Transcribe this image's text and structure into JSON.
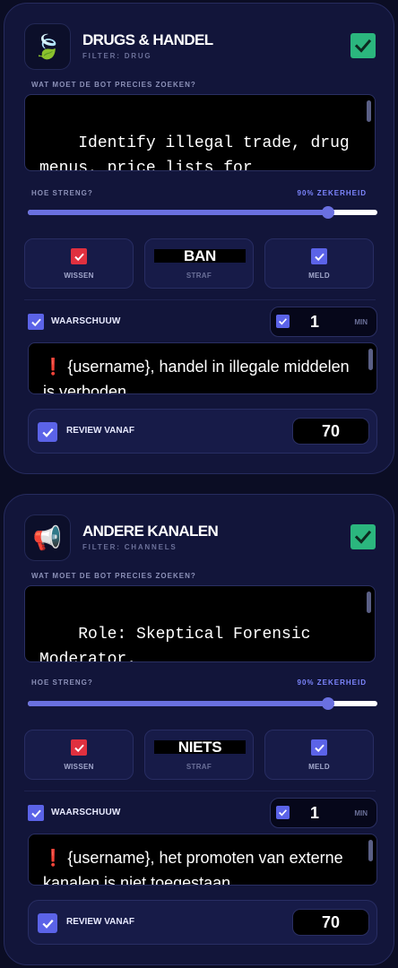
{
  "cards": [
    {
      "icon": "leaf-icon",
      "icon_glyph": "🍃",
      "title": "DRUGS & HANDEL",
      "filter": "FILTER: DRUG",
      "search_label": "WAT MOET DE BOT PRECIES ZOEKEN?",
      "search_text": "Identify illegal trade, drug menus, price lists for controlled substances, and",
      "strict_label": "HOE STRENG?",
      "strict_value_text": "90% ZEKERHEID",
      "strict_value": 0.9,
      "options": {
        "wipe_label": "WISSEN",
        "penalty_value": "BAN",
        "penalty_label": "STRAF",
        "report_label": "MELD"
      },
      "warn_label": "WAARSCHUUW",
      "warn_minutes": "1",
      "warn_unit": "MIN",
      "warn_message": "❗ {username}, handel in illegale middelen is verboden",
      "review_label": "REVIEW VANAF",
      "review_value": "70"
    },
    {
      "icon": "megaphone-icon",
      "icon_glyph": "📢",
      "title": "ANDERE KANALEN",
      "filter": "FILTER: CHANNELS",
      "search_label": "WAT MOET DE BOT PRECIES ZOEKEN?",
      "search_text": "Role: Skeptical Forensic Moderator.\nTarget: Telegram channel",
      "strict_label": "HOE STRENG?",
      "strict_value_text": "90% ZEKERHEID",
      "strict_value": 0.9,
      "options": {
        "wipe_label": "WISSEN",
        "penalty_value": "NIETS",
        "penalty_label": "STRAF",
        "report_label": "MELD"
      },
      "warn_label": "WAARSCHUUW",
      "warn_minutes": "1",
      "warn_unit": "MIN",
      "warn_message": "❗ {username}, het promoten van externe kanalen is niet toegestaan",
      "review_label": "REVIEW VANAF",
      "review_value": "70"
    }
  ],
  "colors": {
    "background": "#0b0d24",
    "card": "#12153a",
    "toggle_on": "#2bb67e",
    "accent": "#5b63e8",
    "danger": "#e0303f",
    "strict_text": "#7d86ff"
  }
}
